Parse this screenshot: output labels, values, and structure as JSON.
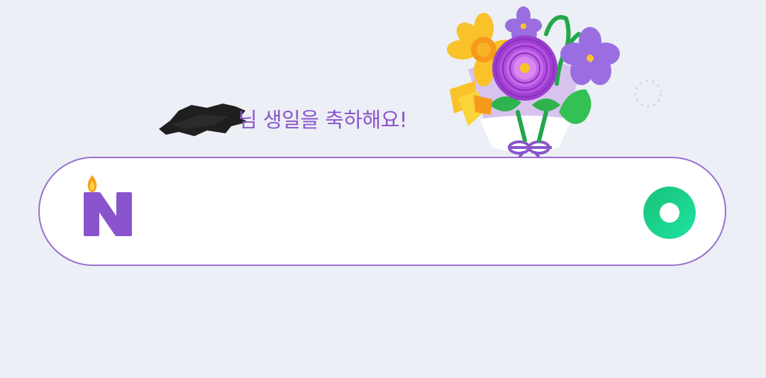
{
  "greeting": {
    "text": "님 생일을 축하해요!",
    "name_redacted": true
  },
  "search": {
    "value": "",
    "placeholder": ""
  },
  "icons": {
    "logo": "naver-birthday-candle-logo",
    "voice": "green-ring-search-icon",
    "decoration": "flower-bouquet"
  },
  "colors": {
    "background": "#eceff5",
    "accent_purple": "#8a55cc",
    "bar_border": "#9a6fd0",
    "green": "#1ec86a"
  }
}
